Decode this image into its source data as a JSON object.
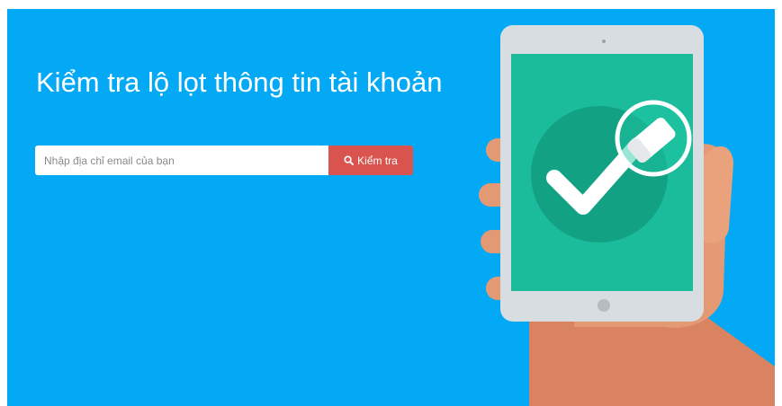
{
  "hero": {
    "title": "Kiểm tra lộ lọt thông tin tài khoản",
    "background_color": "#03a9f4"
  },
  "search": {
    "placeholder": "Nhập địa chỉ email của bạn",
    "value": "",
    "button_label": "Kiểm tra",
    "button_icon": "search-icon",
    "button_color": "#d9534f"
  },
  "illustration": {
    "icon": "phone-checkmark-illustration",
    "screen_color": "#1abc9c",
    "check_circle_color": "#12a283"
  }
}
